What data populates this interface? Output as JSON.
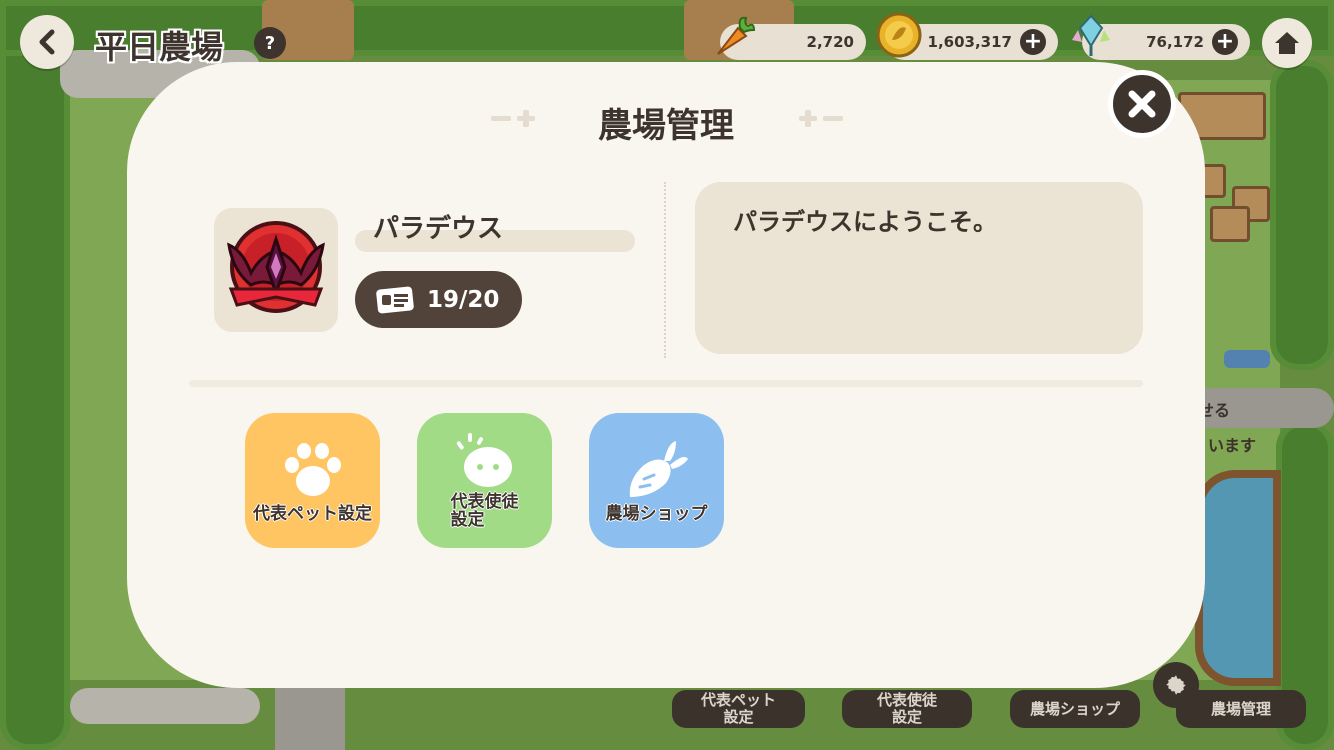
{
  "header": {
    "farm_title": "平日農場",
    "help_icon_glyph": "?",
    "carrots": "2,720",
    "coins": "1,603,317",
    "crystals": "76,172",
    "plus_glyph": "+"
  },
  "icons": {
    "back": "chevron-left-icon",
    "home": "home-icon",
    "close": "close-icon",
    "carrot": "carrot-icon",
    "coin": "coin-icon",
    "crystal": "crystal-icon",
    "id_card": "id-card-icon",
    "paw": "paw-icon",
    "pet": "pet-blob-icon",
    "shop": "radish-icon",
    "gear": "gear-icon"
  },
  "modal": {
    "title": "農場管理",
    "farm_name": "パラデウス",
    "member_count": "19/20",
    "welcome_message": "パラデウスにようこそ。",
    "buttons": [
      {
        "label": "代表ペット設定",
        "color": "#ffc562"
      },
      {
        "label": "代表使徒\n設定",
        "color": "#a2db86"
      },
      {
        "label": "農場ショップ",
        "color": "#8cbff0"
      }
    ]
  },
  "background": {
    "bottom_buttons": [
      {
        "label": "代表ペット\n設定"
      },
      {
        "label": "代表使徒\n設定"
      },
      {
        "label": "農場ショップ"
      },
      {
        "label": "農場管理"
      }
    ],
    "partial_text_1": "せる",
    "partial_text_2": "います"
  },
  "colors": {
    "dark_brown": "#3e342e",
    "modal_bg": "#f9f5ef",
    "panel_beige": "#ebe3d4"
  }
}
